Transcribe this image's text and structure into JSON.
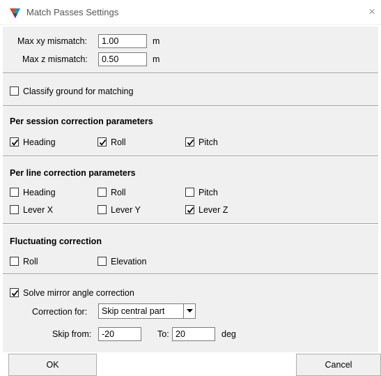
{
  "window": {
    "title": "Match Passes Settings",
    "close_glyph": "×",
    "icon": "app-triangle-icon"
  },
  "tolerances": {
    "max_xy_label": "Max xy mismatch:",
    "max_xy_value": "1.00",
    "max_xy_unit": "m",
    "max_z_label": "Max z mismatch:",
    "max_z_value": "0.50",
    "max_z_unit": "m"
  },
  "classify_ground": {
    "label": "Classify ground for matching",
    "checked": false
  },
  "per_session": {
    "header": "Per session correction parameters",
    "heading": {
      "label": "Heading",
      "checked": true
    },
    "roll": {
      "label": "Roll",
      "checked": true
    },
    "pitch": {
      "label": "Pitch",
      "checked": true
    }
  },
  "per_line": {
    "header": "Per line correction parameters",
    "heading": {
      "label": "Heading",
      "checked": false
    },
    "roll": {
      "label": "Roll",
      "checked": false
    },
    "pitch": {
      "label": "Pitch",
      "checked": false
    },
    "lever_x": {
      "label": "Lever X",
      "checked": false
    },
    "lever_y": {
      "label": "Lever Y",
      "checked": false
    },
    "lever_z": {
      "label": "Lever Z",
      "checked": true
    }
  },
  "fluctuating": {
    "header": "Fluctuating correction",
    "roll": {
      "label": "Roll",
      "checked": false
    },
    "elevation": {
      "label": "Elevation",
      "checked": false
    }
  },
  "mirror": {
    "solve": {
      "label": "Solve mirror angle correction",
      "checked": true
    },
    "correction_for_label": "Correction for:",
    "correction_for_value": "Skip central part",
    "skip_from_label": "Skip from:",
    "skip_from_value": "-20",
    "to_label": "To:",
    "to_value": "20",
    "unit": "deg"
  },
  "buttons": {
    "ok": "OK",
    "cancel": "Cancel"
  }
}
